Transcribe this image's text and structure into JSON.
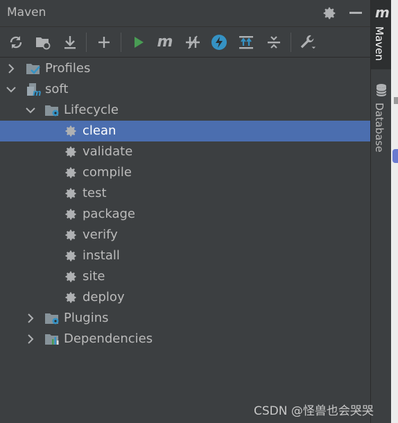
{
  "window": {
    "title": "Maven"
  },
  "toolbar": {
    "icons": [
      "reload-icon",
      "import-folder-icon",
      "download-icon",
      "add-icon",
      "run-icon",
      "maven-goal-icon",
      "toggle-offline-icon",
      "skip-tests-icon",
      "show-dependencies-icon",
      "collapse-all-icon",
      "settings-wrench-icon"
    ]
  },
  "tree": {
    "profiles": "Profiles",
    "project": "soft",
    "lifecycle": "Lifecycle",
    "goals": [
      "clean",
      "validate",
      "compile",
      "test",
      "package",
      "verify",
      "install",
      "site",
      "deploy"
    ],
    "selected_goal": "clean",
    "plugins": "Plugins",
    "dependencies": "Dependencies"
  },
  "rail": {
    "maven_label": "Maven",
    "maven_glyph": "m",
    "database_label": "Database"
  },
  "watermark": "CSDN @怪兽也会哭哭",
  "colors": {
    "background": "#3c3f41",
    "selection": "#4b6eaf",
    "run_green": "#499c54",
    "icon_blue": "#3592c4"
  }
}
